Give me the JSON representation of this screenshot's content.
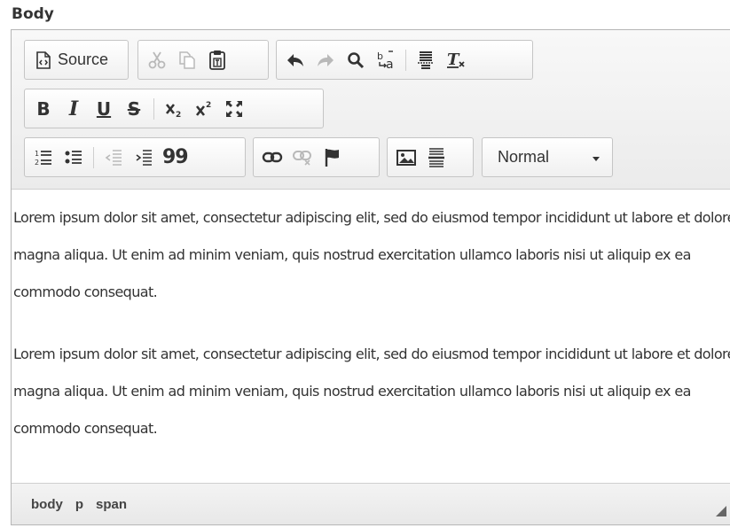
{
  "field": {
    "label": "Body"
  },
  "toolbar": {
    "source_label": "Source",
    "format_value": "Normal",
    "buttons": {
      "bold": "B",
      "italic": "I",
      "underline": "U",
      "strike": "S",
      "blockquote": "99"
    },
    "icons": [
      "source-icon",
      "cut-icon",
      "copy-icon",
      "paste-text-icon",
      "undo-icon",
      "redo-icon",
      "find-icon",
      "replace-icon",
      "page-break-icon",
      "remove-format-icon",
      "bold-icon",
      "italic-icon",
      "underline-icon",
      "strike-icon",
      "subscript-icon",
      "superscript-icon",
      "maximize-icon",
      "numbered-list-icon",
      "bulleted-list-icon",
      "outdent-icon",
      "indent-icon",
      "blockquote-icon",
      "link-icon",
      "unlink-icon",
      "anchor-icon",
      "image-icon",
      "horizontal-line-icon",
      "chevron-down-icon"
    ]
  },
  "content": {
    "paragraphs": [
      "Lorem ipsum dolor sit amet, consectetur adipiscing elit, sed do eiusmod tempor incididunt ut labore et dolore magna aliqua. Ut enim ad minim veniam, quis nostrud exercitation ullamco laboris nisi ut aliquip ex ea commodo consequat.",
      "Lorem ipsum dolor sit amet, consectetur adipiscing elit, sed do eiusmod tempor incididunt ut labore et dolore magna aliqua. Ut enim ad minim veniam, quis nostrud exercitation ullamco laboris nisi ut aliquip ex ea commodo consequat."
    ]
  },
  "statusbar": {
    "path": [
      "body",
      "p",
      "span"
    ]
  },
  "colors": {
    "toolbar_bg": "#ebebeb",
    "border": "#b6b6b6",
    "text": "#333333",
    "disabled": "#b9b9b9"
  }
}
